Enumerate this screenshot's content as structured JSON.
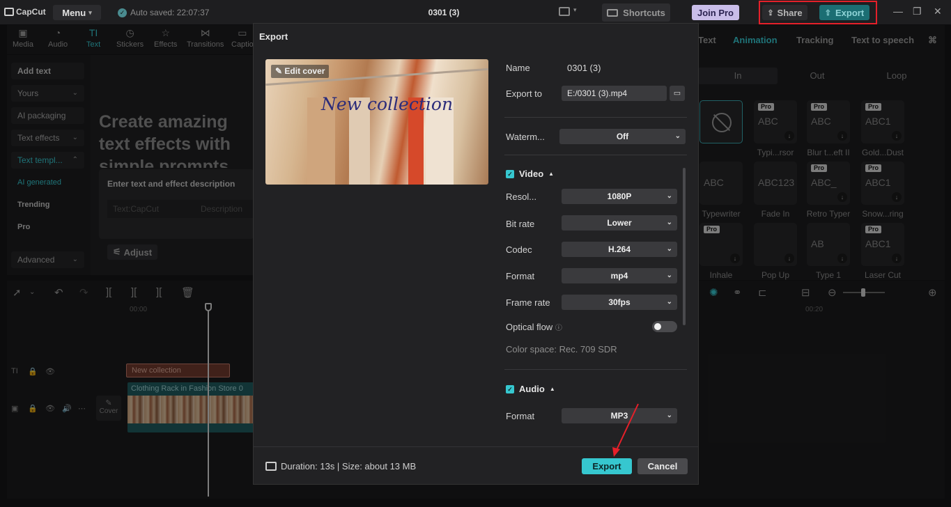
{
  "titlebar": {
    "logo_text": "CapCut",
    "menu_label": "Menu",
    "autosave_text": "Auto saved: 22:07:37",
    "project_title": "0301 (3)",
    "shortcuts_label": "Shortcuts",
    "joinpro_label": "Join Pro",
    "share_label": "Share",
    "export_label": "Export"
  },
  "toolbar": {
    "items": [
      "Media",
      "Audio",
      "Text",
      "Stickers",
      "Effects",
      "Transitions",
      "Captio"
    ],
    "active": "Text"
  },
  "leftpanel": {
    "items": [
      "Add text",
      "Yours",
      "AI packaging",
      "Text effects",
      "Text templ...",
      "AI generated",
      "Trending",
      "Pro",
      "Advanced"
    ]
  },
  "content": {
    "headline": "Create amazing text effects with simple prompts",
    "input_label": "Enter text and effect description",
    "field_text": "Text:CapCut",
    "field_desc": "Description",
    "adjust_label": "Adjust"
  },
  "rightpanel": {
    "tabs": [
      "Text",
      "Animation",
      "Tracking",
      "Text to speech"
    ],
    "active_tab": "Animation",
    "subtabs": [
      "In",
      "Out",
      "Loop"
    ],
    "cards": [
      {
        "label": "",
        "pro": false,
        "sample": ""
      },
      {
        "label": "Typi...rsor",
        "pro": true,
        "sample": "ABC"
      },
      {
        "label": "Blur t...eft II",
        "pro": true,
        "sample": "ABC"
      },
      {
        "label": "Gold...Dust",
        "pro": true,
        "sample": "ABC1"
      },
      {
        "label": "Typewriter",
        "pro": false,
        "sample": "ABC"
      },
      {
        "label": "Fade In",
        "pro": false,
        "sample": "ABC123"
      },
      {
        "label": "Retro Typer",
        "pro": true,
        "sample": "ABC_"
      },
      {
        "label": "Snow...ring",
        "pro": true,
        "sample": "ABC1"
      },
      {
        "label": "Inhale",
        "pro": true,
        "sample": ""
      },
      {
        "label": "Pop Up",
        "pro": false,
        "sample": ""
      },
      {
        "label": "Type 1",
        "pro": false,
        "sample": "AB"
      },
      {
        "label": "Laser Cut",
        "pro": true,
        "sample": "ABC1"
      }
    ],
    "pro_badge": "Pro"
  },
  "timeline": {
    "ruler_start": "00:00",
    "ruler_end": "00:20",
    "text_clip": "New collection",
    "video_clip": "Clothing Rack in Fashion Store",
    "video_clip_suffix": "0",
    "cover_label": "Cover"
  },
  "modal": {
    "title": "Export",
    "edit_cover_label": "Edit cover",
    "preview_caption": "New collection",
    "name_label": "Name",
    "name_value": "0301 (3)",
    "export_to_label": "Export to",
    "export_to_value": "E:/0301 (3).mp4",
    "watermark_label": "Waterm...",
    "watermark_value": "Off",
    "video_section": "Video",
    "resolution_label": "Resol...",
    "resolution_value": "1080P",
    "bitrate_label": "Bit rate",
    "bitrate_value": "Lower",
    "codec_label": "Codec",
    "codec_value": "H.264",
    "format_label": "Format",
    "format_value": "mp4",
    "framerate_label": "Frame rate",
    "framerate_value": "30fps",
    "opticalflow_label": "Optical flow",
    "colorspace_text": "Color space: Rec. 709 SDR",
    "audio_section": "Audio",
    "audio_format_label": "Format",
    "audio_format_value": "MP3",
    "footer_info": "Duration: 13s | Size: about 13 MB",
    "export_button": "Export",
    "cancel_button": "Cancel"
  },
  "colors": {
    "accent": "#36c7cf",
    "highlight": "#e5202a"
  }
}
